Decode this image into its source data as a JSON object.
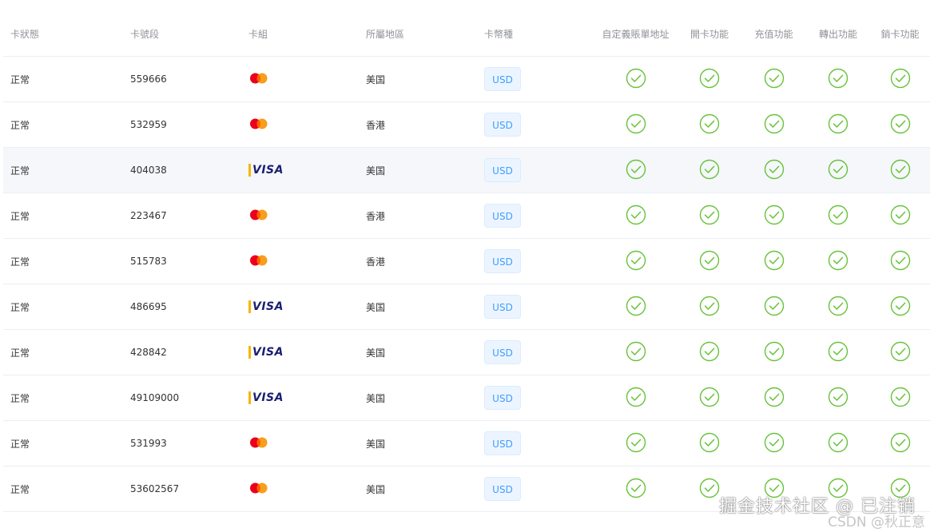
{
  "table": {
    "headers": {
      "status": "卡狀態",
      "bin": "卡號段",
      "group": "卡組",
      "region": "所屬地區",
      "currency": "卡幣種",
      "custom_billing": "自定義賬單地址",
      "open_card": "開卡功能",
      "recharge": "充值功能",
      "transfer_out": "轉出功能",
      "cancel_card": "銷卡功能"
    },
    "highlighted_row": 2,
    "rows": [
      {
        "status": "正常",
        "bin": "559666",
        "brand": "mastercard",
        "region": "美国",
        "currency": "USD"
      },
      {
        "status": "正常",
        "bin": "532959",
        "brand": "mastercard",
        "region": "香港",
        "currency": "USD"
      },
      {
        "status": "正常",
        "bin": "404038",
        "brand": "visa",
        "region": "美国",
        "currency": "USD"
      },
      {
        "status": "正常",
        "bin": "223467",
        "brand": "mastercard",
        "region": "香港",
        "currency": "USD"
      },
      {
        "status": "正常",
        "bin": "515783",
        "brand": "mastercard",
        "region": "香港",
        "currency": "USD"
      },
      {
        "status": "正常",
        "bin": "486695",
        "brand": "visa",
        "region": "美国",
        "currency": "USD"
      },
      {
        "status": "正常",
        "bin": "428842",
        "brand": "visa",
        "region": "美国",
        "currency": "USD"
      },
      {
        "status": "正常",
        "bin": "49109000",
        "brand": "visa",
        "region": "美国",
        "currency": "USD"
      },
      {
        "status": "正常",
        "bin": "531993",
        "brand": "mastercard",
        "region": "美国",
        "currency": "USD"
      },
      {
        "status": "正常",
        "bin": "53602567",
        "brand": "mastercard",
        "region": "美国",
        "currency": "USD"
      }
    ]
  },
  "brands": {
    "visa": {
      "label": "VISA",
      "icon": "visa-logo-icon"
    },
    "mastercard": {
      "label": "",
      "icon": "mastercard-logo-icon"
    }
  },
  "feature_icon": "check-circle-icon",
  "colors": {
    "check": "#67c23a",
    "visa_blue": "#1a1f71",
    "visa_gold": "#f7b600",
    "mc_red": "#eb001b",
    "mc_orange": "#f79e1b",
    "usd_text": "#409eff",
    "usd_bg": "#ecf5ff",
    "header_text": "#909399",
    "row_highlight": "#f5f7fa"
  },
  "watermark": {
    "main": "掘金技术社区 @ 已注销",
    "sub": "CSDN @秋正意"
  }
}
